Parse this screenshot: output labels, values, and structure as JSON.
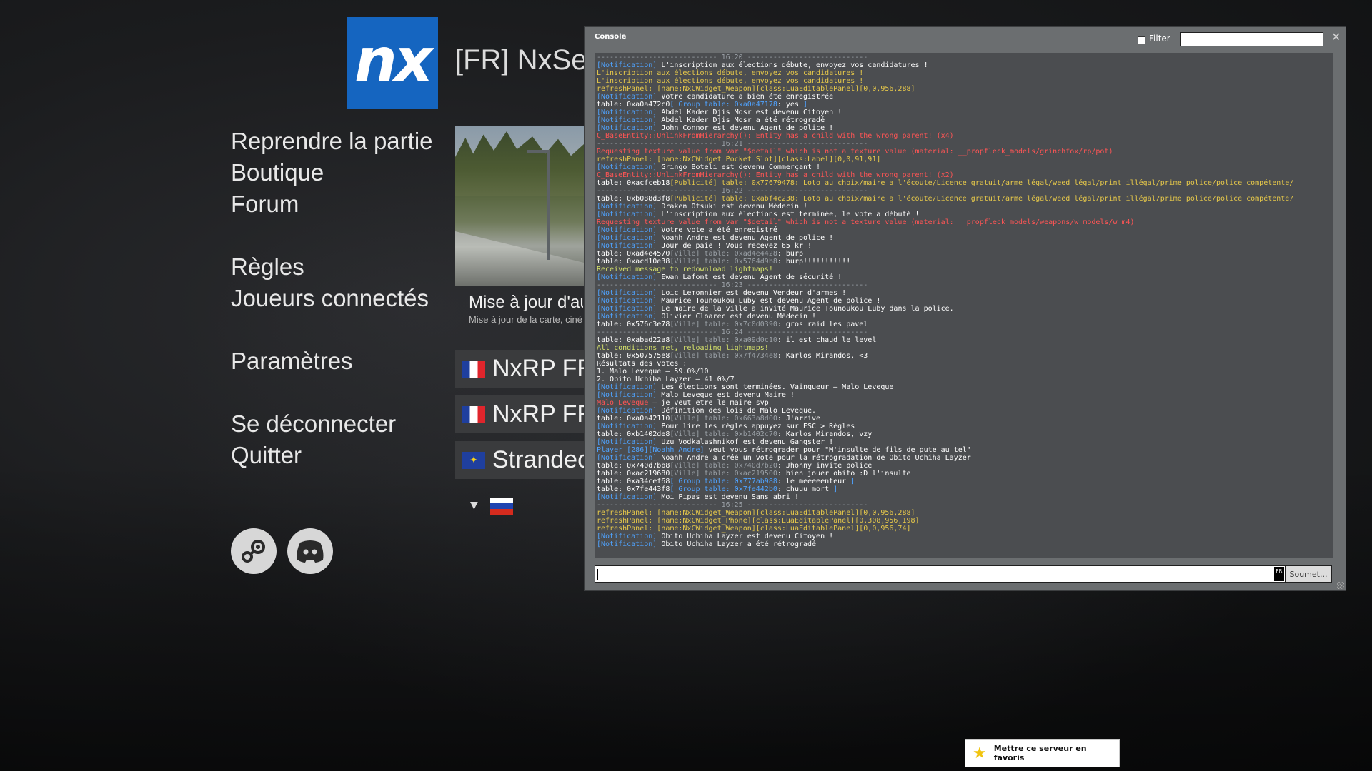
{
  "server": {
    "logo_text": "nx",
    "name": "[FR] NxServ"
  },
  "menu": [
    {
      "label": "Reprendre la partie"
    },
    {
      "label": "Boutique"
    },
    {
      "label": "Forum"
    },
    {
      "label": "Règles"
    },
    {
      "label": "Joueurs connectés"
    },
    {
      "label": "Paramètres"
    },
    {
      "label": "Se déconnecter"
    },
    {
      "label": "Quitter"
    }
  ],
  "news": {
    "title": "Mise à jour d'au",
    "subtitle": "Mise à jour de la carte, ciné"
  },
  "servers": [
    {
      "label": "NxRP FR",
      "flag": "fr"
    },
    {
      "label": "NxRP FR",
      "flag": "fr"
    },
    {
      "label": "Strandec",
      "flag": "eu"
    }
  ],
  "language": {
    "arrow": "▼",
    "flag": "ru"
  },
  "social": [
    "steam-icon",
    "discord-icon"
  ],
  "console": {
    "title": "Console",
    "filter_label": "Filter",
    "filter_value": "",
    "close": "✕",
    "input_lang": "FR",
    "submit_label": "Soumet...",
    "log": [
      {
        "p": [
          [
            "c-grey",
            "---------------------------- 16:20 ----------------------------"
          ]
        ]
      },
      {
        "p": [
          [
            "c-blue",
            "[Notification] "
          ],
          [
            "c-white",
            "L'inscription aux élections débute, envoyez vos candidatures !"
          ]
        ]
      },
      {
        "p": [
          [
            "c-yellow",
            "L'inscription aux élections débute, envoyez vos candidatures !"
          ]
        ]
      },
      {
        "p": [
          [
            "c-yellow",
            "L'inscription aux élections débute, envoyez vos candidatures !"
          ]
        ]
      },
      {
        "p": [
          [
            "c-yellow",
            "refreshPanel: [name:NxCWidget_Weapon][class:LuaEditablePanel][0,0,956,288]"
          ]
        ]
      },
      {
        "p": [
          [
            "c-blue",
            "[Notification] "
          ],
          [
            "c-white",
            "Votre candidature a bien été enregistrée"
          ]
        ]
      },
      {
        "p": [
          [
            "c-white",
            "table: 0xa0a472c0"
          ],
          [
            "c-blue",
            "[ Group table: 0xa0a47178"
          ],
          [
            "c-white",
            ": yes "
          ],
          [
            "c-blue",
            "]"
          ]
        ]
      },
      {
        "p": [
          [
            "c-blue",
            "[Notification] "
          ],
          [
            "c-white",
            "Abdel Kader Djis Mosr est devenu Citoyen !"
          ]
        ]
      },
      {
        "p": [
          [
            "c-blue",
            "[Notification] "
          ],
          [
            "c-white",
            "Abdel Kader Djis Mosr a été rétrogradé"
          ]
        ]
      },
      {
        "p": [
          [
            "c-blue",
            "[Notification] "
          ],
          [
            "c-white",
            "John Connor est devenu Agent de police !"
          ]
        ]
      },
      {
        "p": [
          [
            "c-red",
            "C_BaseEntity::UnlinkFromHierarchy(): Entity has a child with the wrong parent! (x4)"
          ]
        ]
      },
      {
        "p": [
          [
            "c-grey",
            "---------------------------- 16:21 ----------------------------"
          ]
        ]
      },
      {
        "p": [
          [
            "c-red",
            "Requesting texture value from var \"$detail\" which is not a texture value (material: __propfleck_models/grinchfox/rp/pot)"
          ]
        ]
      },
      {
        "p": [
          [
            "c-yellow",
            "refreshPanel: [name:NxCWidget_Pocket_Slot][class:Label][0,0,91,91]"
          ]
        ]
      },
      {
        "p": [
          [
            "c-blue",
            "[Notification] "
          ],
          [
            "c-white",
            "Gringo Boteli est devenu Commerçant !"
          ]
        ]
      },
      {
        "p": [
          [
            "c-red",
            "C_BaseEntity::UnlinkFromHierarchy(): Entity has a child with the wrong parent! (x2)"
          ]
        ]
      },
      {
        "p": [
          [
            "c-white",
            "table: 0xacfceb18"
          ],
          [
            "c-yellow",
            "[Publicité] table: 0x77679478: Loto au choix/maire a l'écoute/Licence gratuit/arme légal/weed légal/print illégal/prime police/police compétente/"
          ]
        ]
      },
      {
        "p": [
          [
            "c-grey",
            "---------------------------- 16:22 ----------------------------"
          ]
        ]
      },
      {
        "p": [
          [
            "c-white",
            "table: 0xb088d3f8"
          ],
          [
            "c-yellow",
            "[Publicité] table: 0xabf4c238: Loto au choix/maire a l'écoute/Licence gratuit/arme légal/weed légal/print illégal/prime police/police compétente/"
          ]
        ]
      },
      {
        "p": [
          [
            "c-blue",
            "[Notification] "
          ],
          [
            "c-white",
            "Draken Otsuki est devenu Médecin !"
          ]
        ]
      },
      {
        "p": [
          [
            "c-blue",
            "[Notification] "
          ],
          [
            "c-white",
            "L'inscription aux élections est terminée, le vote a débuté !"
          ]
        ]
      },
      {
        "p": [
          [
            "c-red",
            "Requesting texture value from var \"$detail\" which is not a texture value (material: __propfleck_models/weapons/w_models/w_m4)"
          ]
        ]
      },
      {
        "p": [
          [
            "c-blue",
            "[Notification] "
          ],
          [
            "c-white",
            "Votre vote a été enregistré"
          ]
        ]
      },
      {
        "p": [
          [
            "c-blue",
            "[Notification] "
          ],
          [
            "c-white",
            "Noahh Andre est devenu Agent de police !"
          ]
        ]
      },
      {
        "p": [
          [
            "c-blue",
            "[Notification] "
          ],
          [
            "c-white",
            "Jour de paie ! Vous recevez 65 kr !"
          ]
        ]
      },
      {
        "p": [
          [
            "c-white",
            "table: 0xad4e4570"
          ],
          [
            "c-grey",
            "[Ville] table: 0xad4e4428"
          ],
          [
            "c-white",
            ": burp"
          ]
        ]
      },
      {
        "p": [
          [
            "c-white",
            "table: 0xacd10e38"
          ],
          [
            "c-grey",
            "[Ville] table: 0x5764d9b8"
          ],
          [
            "c-white",
            ": burp!!!!!!!!!!!"
          ]
        ]
      },
      {
        "p": [
          [
            "c-green",
            "Received message to redownload lightmaps!"
          ]
        ]
      },
      {
        "p": [
          [
            "c-blue",
            "[Notification] "
          ],
          [
            "c-white",
            "Ewan Lafont est devenu Agent de sécurité !"
          ]
        ]
      },
      {
        "p": [
          [
            "c-grey",
            "---------------------------- 16:23 ----------------------------"
          ]
        ]
      },
      {
        "p": [
          [
            "c-blue",
            "[Notification] "
          ],
          [
            "c-white",
            "Loic Lemonnier est devenu Vendeur d'armes !"
          ]
        ]
      },
      {
        "p": [
          [
            "c-blue",
            "[Notification] "
          ],
          [
            "c-white",
            "Maurice Tounoukou Luby est devenu Agent de police !"
          ]
        ]
      },
      {
        "p": [
          [
            "c-blue",
            "[Notification] "
          ],
          [
            "c-white",
            "Le maire de la ville a invité Maurice Tounoukou Luby dans la police."
          ]
        ]
      },
      {
        "p": [
          [
            "c-blue",
            "[Notification] "
          ],
          [
            "c-white",
            "Olivier Cloarec est devenu Médecin !"
          ]
        ]
      },
      {
        "p": [
          [
            "c-white",
            "table: 0x576c3e78"
          ],
          [
            "c-grey",
            "[Ville] table: 0x7c0d0390"
          ],
          [
            "c-white",
            ": gros raid les pavel"
          ]
        ]
      },
      {
        "p": [
          [
            "c-grey",
            "---------------------------- 16:24 ----------------------------"
          ]
        ]
      },
      {
        "p": [
          [
            "c-white",
            "table: 0xabad22a8"
          ],
          [
            "c-grey",
            "[Ville] table: 0xa09d0c10"
          ],
          [
            "c-white",
            ": il est chaud le level"
          ]
        ]
      },
      {
        "p": [
          [
            "c-green",
            "All conditions met, reloading lightmaps!"
          ]
        ]
      },
      {
        "p": [
          [
            "c-white",
            "table: 0x507575e8"
          ],
          [
            "c-grey",
            "[Ville] table: 0x7f4734e8"
          ],
          [
            "c-white",
            ": Karlos Mirandos, <3"
          ]
        ]
      },
      {
        "p": [
          [
            "c-white",
            "Résultats des votes :"
          ]
        ]
      },
      {
        "p": [
          [
            "c-white",
            "1. Malo Leveque — 59.0%/10"
          ]
        ]
      },
      {
        "p": [
          [
            "c-white",
            "2. Obito Uchiha Layzer — 41.0%/7"
          ]
        ]
      },
      {
        "p": [
          [
            "c-blue",
            "[Notification] "
          ],
          [
            "c-white",
            "Les élections sont terminées. Vainqueur — Malo Leveque"
          ]
        ]
      },
      {
        "p": [
          [
            "c-blue",
            "[Notification] "
          ],
          [
            "c-white",
            "Malo Leveque est devenu Maire !"
          ]
        ]
      },
      {
        "p": [
          [
            "c-red",
            "Malo Leveque"
          ],
          [
            "c-white",
            " — je veut etre le maire svp"
          ]
        ]
      },
      {
        "p": [
          [
            "c-blue",
            "[Notification] "
          ],
          [
            "c-white",
            "Définition des lois de Malo Leveque."
          ]
        ]
      },
      {
        "p": [
          [
            "c-white",
            "table: 0xa0a42110"
          ],
          [
            "c-grey",
            "[Ville] table: 0x663a8d00"
          ],
          [
            "c-white",
            ": J'arrive"
          ]
        ]
      },
      {
        "p": [
          [
            "c-blue",
            "[Notification] "
          ],
          [
            "c-white",
            "Pour lire les règles appuyez sur ESC > Règles"
          ]
        ]
      },
      {
        "p": [
          [
            "c-white",
            "table: 0xb1402de8"
          ],
          [
            "c-grey",
            "[Ville] table: 0xb1402c70"
          ],
          [
            "c-white",
            ": Karlos Mirandos, vzy"
          ]
        ]
      },
      {
        "p": [
          [
            "c-blue",
            "[Notification] "
          ],
          [
            "c-white",
            "Uzu Vodkalashnikof est devenu Gangster !"
          ]
        ]
      },
      {
        "p": [
          [
            "c-blue",
            "Player [286][Noahh Andre] "
          ],
          [
            "c-white",
            "veut vous rétrograder pour \"M'insulte de fils de pute au tel\""
          ]
        ]
      },
      {
        "p": [
          [
            "c-blue",
            "[Notification] "
          ],
          [
            "c-white",
            "Noahh Andre a créé un vote pour la rétrogradation de Obito Uchiha Layzer"
          ]
        ]
      },
      {
        "p": [
          [
            "c-white",
            "table: 0x740d7bb8"
          ],
          [
            "c-grey",
            "[Ville] table: 0x740d7b20"
          ],
          [
            "c-white",
            ": Jhonny invite police"
          ]
        ]
      },
      {
        "p": [
          [
            "c-white",
            "table: 0xac219680"
          ],
          [
            "c-grey",
            "[Ville] table: 0xac219500"
          ],
          [
            "c-white",
            ": bien jouer obito :D l'insulte"
          ]
        ]
      },
      {
        "p": [
          [
            "c-white",
            "table: 0xa34cef68"
          ],
          [
            "c-blue",
            "[ Group table: 0x777ab988"
          ],
          [
            "c-white",
            ": le meeeeenteur "
          ],
          [
            "c-blue",
            "]"
          ]
        ]
      },
      {
        "p": [
          [
            "c-white",
            "table: 0x7fe443f8"
          ],
          [
            "c-blue",
            "[ Group table: 0x7fe442b0"
          ],
          [
            "c-white",
            ": chuuu mort "
          ],
          [
            "c-blue",
            "]"
          ]
        ]
      },
      {
        "p": [
          [
            "c-blue",
            "[Notification] "
          ],
          [
            "c-white",
            "Moi Pipas est devenu Sans abri !"
          ]
        ]
      },
      {
        "p": [
          [
            "c-grey",
            "---------------------------- 16:25 ----------------------------"
          ]
        ]
      },
      {
        "p": [
          [
            "c-yellow",
            "refreshPanel: [name:NxCWidget_Weapon][class:LuaEditablePanel][0,0,956,288]"
          ]
        ]
      },
      {
        "p": [
          [
            "c-yellow",
            "refreshPanel: [name:NxCWidget_Phone][class:LuaEditablePanel][0,308,956,198]"
          ]
        ]
      },
      {
        "p": [
          [
            "c-yellow",
            "refreshPanel: [name:NxCWidget_Weapon][class:LuaEditablePanel][0,0,956,74]"
          ]
        ]
      },
      {
        "p": [
          [
            "c-blue",
            "[Notification] "
          ],
          [
            "c-white",
            "Obito Uchiha Layzer est devenu Citoyen !"
          ]
        ]
      },
      {
        "p": [
          [
            "c-blue",
            "[Notification] "
          ],
          [
            "c-white",
            "Obito Uchiha Layzer a été rétrogradé"
          ]
        ]
      }
    ]
  },
  "favorite": {
    "label": "Mettre ce serveur en favoris"
  }
}
